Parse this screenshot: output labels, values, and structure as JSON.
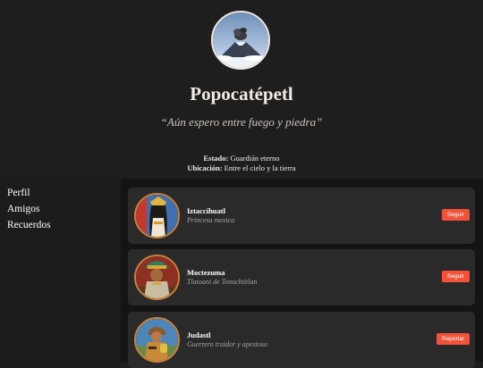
{
  "profile": {
    "name": "Popocatépetl",
    "quote": "“Aún espero entre fuego y piedra”",
    "status_label": "Estado:",
    "status_value": "Guardián eterno",
    "location_label": "Ubicación:",
    "location_value": "Entre el cielo y la tierra"
  },
  "sidebar": {
    "items": [
      {
        "label": "Perfil"
      },
      {
        "label": "Amigos"
      },
      {
        "label": "Recuerdos"
      }
    ]
  },
  "friends": [
    {
      "name": "Iztaccíhuatl",
      "subtitle": "Princesa mexica",
      "action": "Seguir"
    },
    {
      "name": "Moctezuma",
      "subtitle": "Tlatoani de Tenochtitlan",
      "action": "Seguir"
    },
    {
      "name": "Judastl",
      "subtitle": "Guerrero traidor y apestoso",
      "action": "Reportar"
    }
  ],
  "colors": {
    "accent_button": "#f25238",
    "background": "#1e1d1d",
    "card": "#2b2a2a"
  }
}
